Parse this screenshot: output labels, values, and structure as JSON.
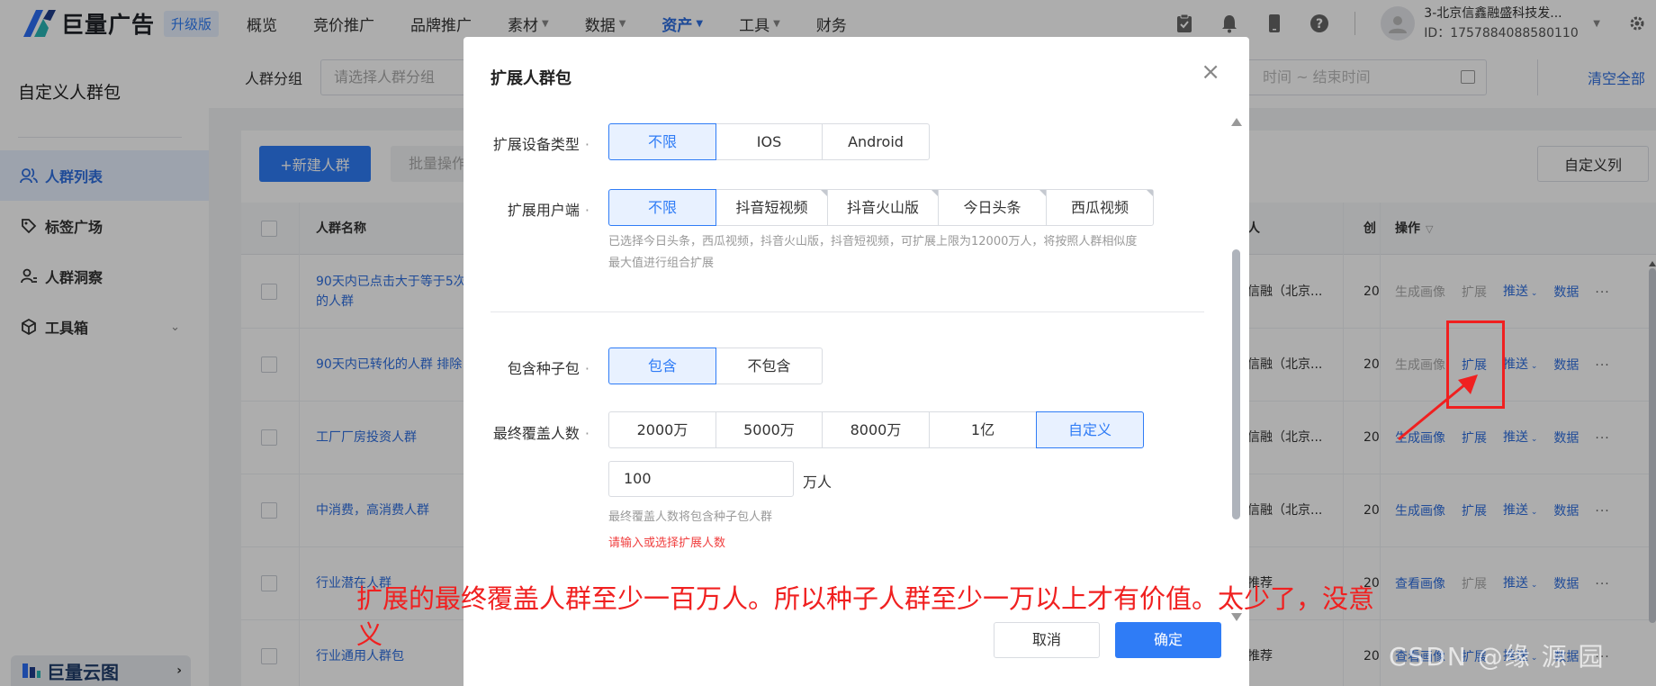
{
  "brand": {
    "name": "巨量广告",
    "badge": "升级版"
  },
  "nav": [
    {
      "label": "概览",
      "caret": false,
      "active": false
    },
    {
      "label": "竞价推广",
      "caret": false,
      "active": false
    },
    {
      "label": "品牌推广",
      "caret": false,
      "active": false
    },
    {
      "label": "素材",
      "caret": true,
      "active": false
    },
    {
      "label": "数据",
      "caret": true,
      "active": false
    },
    {
      "label": "资产",
      "caret": true,
      "active": true
    },
    {
      "label": "工具",
      "caret": true,
      "active": false
    },
    {
      "label": "财务",
      "caret": false,
      "active": false
    }
  ],
  "account": {
    "name": "3-北京信鑫融盛科技发...",
    "id": "ID：1757884088580110"
  },
  "sidebar": {
    "title": "自定义人群包",
    "items": [
      {
        "label": "人群列表",
        "icon": "users-icon",
        "active": true
      },
      {
        "label": "标签广场",
        "icon": "tag-icon",
        "active": false
      },
      {
        "label": "人群洞察",
        "icon": "user-insight-icon",
        "active": false
      },
      {
        "label": "工具箱",
        "icon": "cube-icon",
        "active": false,
        "expandable": true
      }
    ],
    "cloud": "巨量云图"
  },
  "filter": {
    "group_label": "人群分组",
    "group_placeholder": "请选择人群分组",
    "date_placeholder": "时间 ~ 结束时间",
    "clear_all": "清空全部"
  },
  "toolbar": {
    "new": "+新建人群",
    "batch": "批量操作",
    "columns": "自定义列"
  },
  "table": {
    "headers": {
      "name": "人群名称",
      "owner": "人",
      "created": "创",
      "ops": "操作"
    },
    "rows": [
      {
        "name": "90天内已点击大于等于5次的人群",
        "owner": "信融（北京...",
        "created": "20",
        "ops": [
          [
            "生成画像",
            false
          ],
          [
            "扩展",
            false
          ],
          [
            "推送",
            true,
            true
          ],
          [
            "数据",
            true
          ]
        ]
      },
      {
        "name": "90天内已转化的人群 排除",
        "owner": "信融（北京...",
        "created": "20",
        "ops": [
          [
            "生成画像",
            false
          ],
          [
            "扩展",
            true
          ],
          [
            "推送",
            true,
            true
          ],
          [
            "数据",
            true
          ]
        ]
      },
      {
        "name": "工厂厂房投资人群",
        "owner": "信融（北京...",
        "created": "20",
        "ops": [
          [
            "生成画像",
            true
          ],
          [
            "扩展",
            true
          ],
          [
            "推送",
            true,
            true
          ],
          [
            "数据",
            true
          ]
        ]
      },
      {
        "name": "中消费，高消费人群",
        "owner": "信融（北京...",
        "created": "20",
        "ops": [
          [
            "生成画像",
            true
          ],
          [
            "扩展",
            true
          ],
          [
            "推送",
            true,
            true
          ],
          [
            "数据",
            true
          ]
        ]
      },
      {
        "name": "行业潜在人群",
        "owner": "推荐",
        "created": "20",
        "ops": [
          [
            "查看画像",
            true
          ],
          [
            "扩展",
            false
          ],
          [
            "推送",
            true,
            true
          ],
          [
            "数据",
            true
          ]
        ]
      },
      {
        "name": "行业通用人群包",
        "owner": "推荐",
        "created": "20",
        "ops": [
          [
            "查看画像",
            true
          ],
          [
            "扩展",
            true
          ],
          [
            "推送",
            true,
            true
          ],
          [
            "数据",
            true
          ]
        ]
      }
    ]
  },
  "modal": {
    "title": "扩展人群包",
    "device": {
      "label": "扩展设备类型",
      "options": [
        "不限",
        "IOS",
        "Android"
      ],
      "selected": 0
    },
    "client": {
      "label": "扩展用户端",
      "options": [
        "不限",
        "抖音短视频",
        "抖音火山版",
        "今日头条",
        "西瓜视频"
      ],
      "selected": 0,
      "hint_line1": "已选择今日头条，西瓜视频，抖音火山版，抖音短视频，可扩展上限为12000万人，将按照人群相似度",
      "hint_line2": "最大值进行组合扩展"
    },
    "seed": {
      "label": "包含种子包",
      "options": [
        "包含",
        "不包含"
      ],
      "selected": 0
    },
    "coverage": {
      "label": "最终覆盖人数",
      "options": [
        "2000万",
        "5000万",
        "8000万",
        "1亿",
        "自定义"
      ],
      "selected": 4,
      "input_value": "100",
      "unit": "万人",
      "hint": "最终覆盖人数将包含种子包人群",
      "error": "请输入或选择扩展人数"
    },
    "cancel": "取消",
    "confirm": "确定"
  },
  "annotation": {
    "text": "扩展的最终覆盖人群至少一百万人。所以种子人群至少一万以上才有价值。太少了，没意义",
    "color": "#f02020"
  },
  "watermark": "CSDN @缘  源  园"
}
